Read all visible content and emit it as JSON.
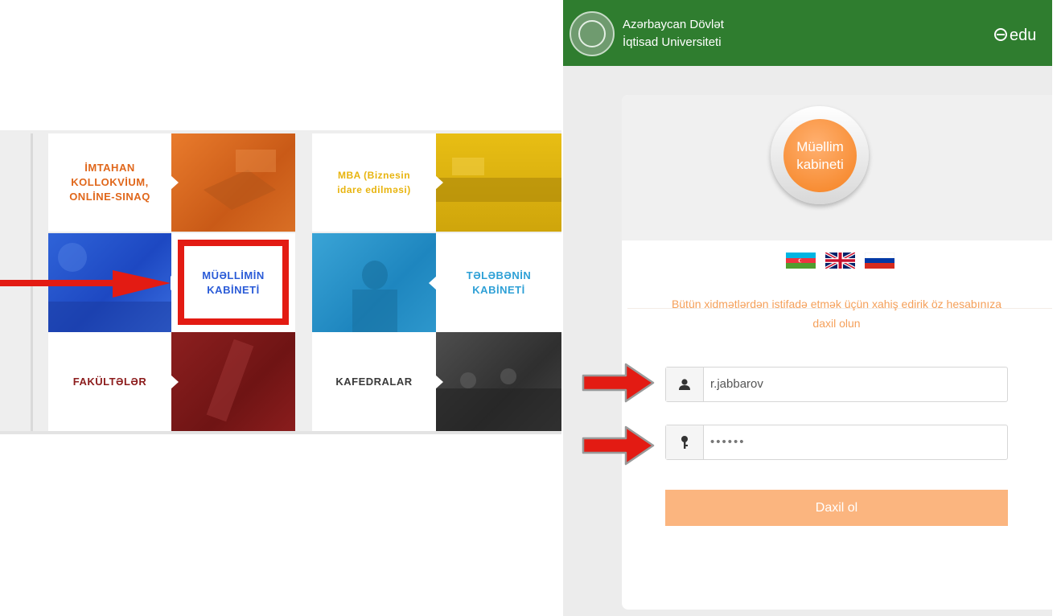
{
  "tiles": {
    "exam": "İMTAHAN KOLLOKVİUM, ONLİNE-SINAQ",
    "mba": "MBA (Biznesin idare edilməsi)",
    "teacher": "MÜƏLLİMİN KABİNETİ",
    "student": "TƏLƏBƏNİN KABİNETİ",
    "faculties": "FAKÜLTƏLƏR",
    "departments": "KAFEDRALAR"
  },
  "header": {
    "title_line1": "Azərbaycan Dövlət",
    "title_line2": "İqtisad Universiteti",
    "brand": "edu"
  },
  "login": {
    "avatar_label": "Müəllim kabineti",
    "languages": [
      "az",
      "en",
      "ru"
    ],
    "message": "Bütün xidmətlərdən istifadə etmək üçün xahiş edirik öz hesabınıza daxil olun",
    "username_value": "r.jabbarov",
    "password_value": "••••••",
    "submit_label": "Daxil ol"
  },
  "colors": {
    "brand_green": "#2f7d2f",
    "accent_orange": "#f5811f",
    "highlight_red": "#e31b13"
  }
}
